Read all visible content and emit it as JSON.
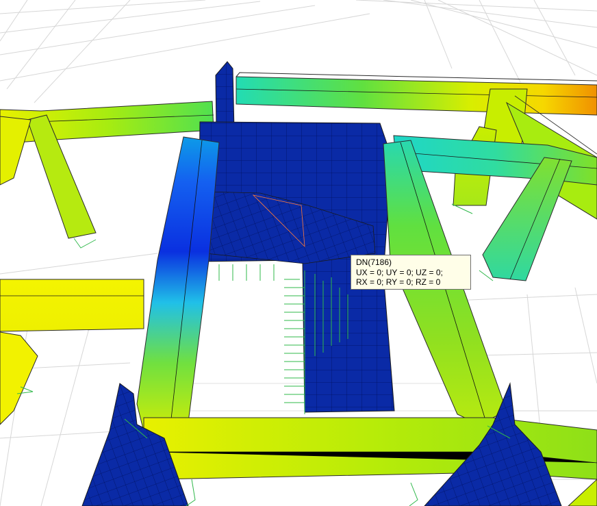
{
  "tooltip": {
    "node_id": "DN(7186)",
    "translations": "UX = 0; UY = 0; UZ = 0;",
    "rotations": "RX = 0; RY = 0; RZ = 0"
  },
  "colors": {
    "mesh_blue": "#0a2aa6",
    "beam_yellow": "#f2f200",
    "beam_green": "#78e018",
    "beam_cyan": "#20d8c0",
    "support_green": "#2fb84a",
    "grid_line": "#d4d4d4",
    "tooltip_bg": "#fffee8"
  }
}
